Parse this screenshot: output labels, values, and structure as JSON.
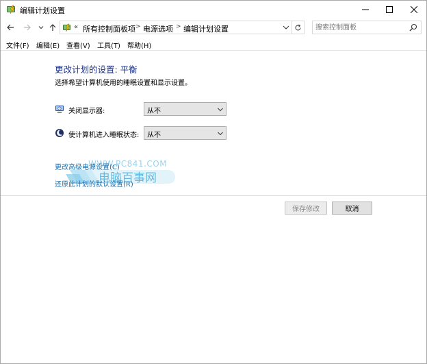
{
  "window": {
    "title": "编辑计划设置",
    "icons": {
      "app": "power-options-icon",
      "minimize": "minimize-icon",
      "maximize": "maximize-icon",
      "close": "close-icon"
    }
  },
  "nav": {
    "chevrons": "«",
    "breadcrumbs": [
      "所有控制面板项",
      "电源选项",
      "编辑计划设置"
    ],
    "search_placeholder": "搜索控制面板"
  },
  "menu": [
    "文件(F)",
    "编辑(E)",
    "查看(V)",
    "工具(T)",
    "帮助(H)"
  ],
  "content": {
    "title": "更改计划的设置: 平衡",
    "subtitle": "选择希望计算机使用的睡眠设置和显示设置。",
    "settings": [
      {
        "label": "关闭显示器:",
        "value": "从不",
        "icon": "monitor-icon"
      },
      {
        "label": "使计算机进入睡眠状态:",
        "value": "从不",
        "icon": "sleep-moon-icon"
      }
    ],
    "links": [
      "更改高级电源设置(C)",
      "还原此计划的默认设置(R)"
    ]
  },
  "watermark": {
    "url": "WWW.PC841.COM",
    "text": "电脑百事网"
  },
  "buttons": {
    "save": "保存修改",
    "cancel": "取消"
  },
  "colors": {
    "title": "#1e3287",
    "link": "#1a6fb0",
    "watermark": "#66b9e0"
  }
}
